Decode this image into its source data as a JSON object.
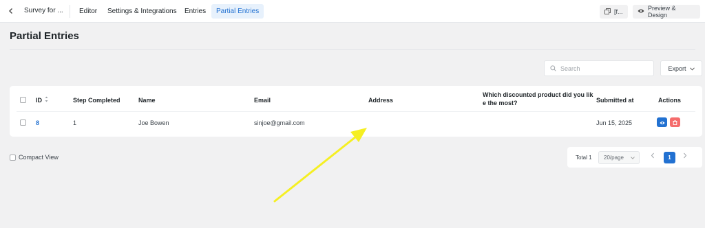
{
  "header": {
    "form_title": "Survey for ...",
    "tabs": [
      {
        "label": "Editor"
      },
      {
        "label": "Settings & Integrations"
      },
      {
        "label": "Entries"
      },
      {
        "label": "Partial Entries",
        "active": true
      }
    ],
    "shortcode_button": "[f...",
    "preview_button": "Preview & Design"
  },
  "page": {
    "title": "Partial Entries"
  },
  "toolbar": {
    "search_placeholder": "Search",
    "export_label": "Export"
  },
  "table": {
    "columns": [
      "ID",
      "Step Completed",
      "Name",
      "Email",
      "Address",
      "Which discounted product did you like the most?",
      "Submitted at",
      "Actions"
    ],
    "rows": [
      {
        "id": "8",
        "step": "1",
        "name": "Joe Bowen",
        "email": "sinjoe@gmail.com",
        "address": "",
        "product": "",
        "submitted": "Jun 15, 2025"
      }
    ]
  },
  "compact_view_label": "Compact View",
  "pagination": {
    "total": "Total 1",
    "per_page": "20/page",
    "current_page": "1"
  },
  "colors": {
    "accent": "#2271d1",
    "delete": "#f56c6c",
    "annotation_arrow": "#f5ef23"
  },
  "icons": [
    "back-arrow-icon",
    "copy-icon",
    "eye-icon",
    "search-icon",
    "chevron-down-icon",
    "sort-icon",
    "delete-icon",
    "chevron-left-icon",
    "chevron-right-icon"
  ]
}
